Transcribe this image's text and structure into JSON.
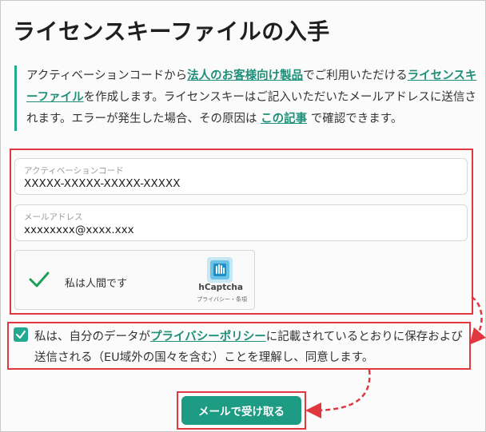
{
  "page_title": "ライセンスキーファイルの入手",
  "info": {
    "text1": "アクティベーションコードから",
    "link1": "法人のお客様向け製品",
    "text2": "でご利用いただける",
    "link2": "ライセンスキーファイル",
    "text3": "を作成します。ライセンスキーはご記入いただいたメールアドレスに送信されます。エラーが発生した場合、その原因は ",
    "link3": "この記事",
    "text4": " で確認できます。"
  },
  "form": {
    "activation_code": {
      "label": "アクティベーションコード",
      "value": "XXXXX-XXXXX-XXXXX-XXXXX"
    },
    "email": {
      "label": "メールアドレス",
      "value": "xxxxxxxx@xxxx.xxx"
    }
  },
  "captcha": {
    "label": "私は人間です",
    "brand": "hCaptcha",
    "links": "プライバシー・条項"
  },
  "consent": {
    "text1": "私は、自分のデータが",
    "link": "プライバシーポリシー",
    "text2": "に記載されているとおりに保存および送信される（EU域外の国々を含む）ことを理解し、同意します。"
  },
  "submit_label": "メールで受け取る",
  "colors": {
    "accent": "#1e9b83",
    "highlight": "#e0383e"
  }
}
